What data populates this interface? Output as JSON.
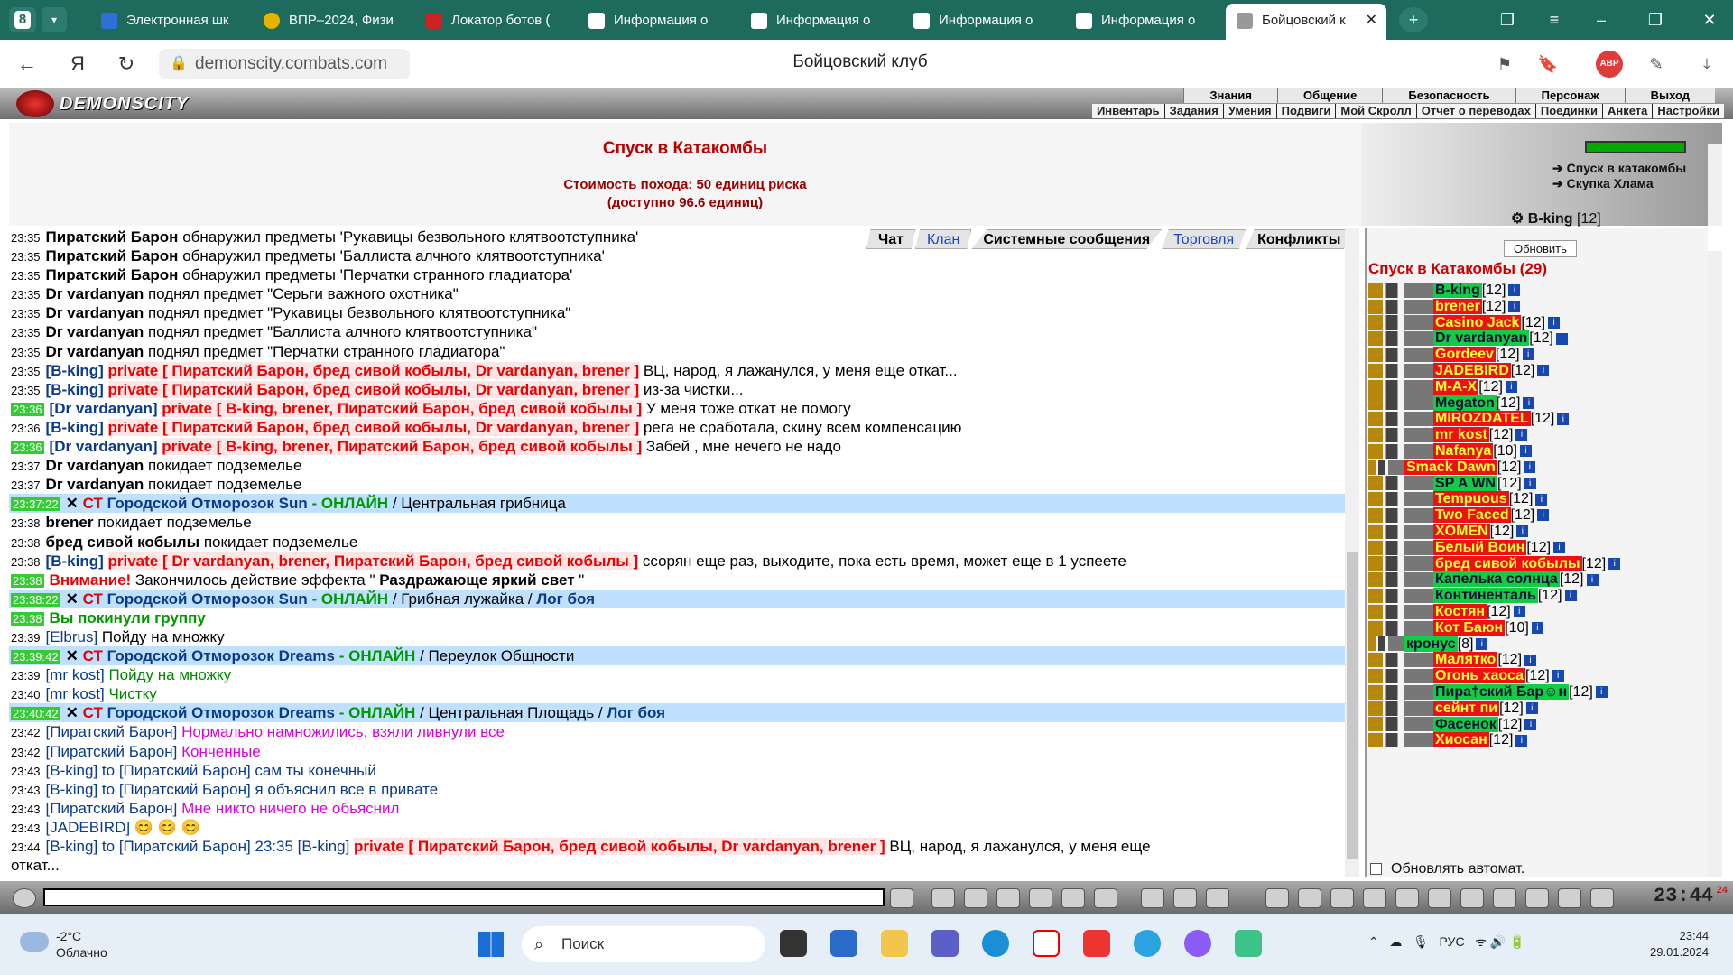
{
  "browser": {
    "tab_count": "8",
    "tabs": [
      {
        "label": "Электронная шк"
      },
      {
        "label": "ВПР–2024, Физи"
      },
      {
        "label": "Локатор ботов ("
      },
      {
        "label": "Информация о"
      },
      {
        "label": "Информация о"
      },
      {
        "label": "Информация о"
      },
      {
        "label": "Информация о"
      },
      {
        "label": "Бойцовский к"
      }
    ],
    "url": "demonscity.combats.com",
    "page_title": "Бойцовский клуб",
    "abp_label": "ABP"
  },
  "game": {
    "logo": "DEMONSCITY",
    "top_menu": [
      "Знания",
      "Общение",
      "Безопасность",
      "Персонаж",
      "Выход"
    ],
    "sub_menu": [
      "Инвентарь",
      "Задания",
      "Умения",
      "Подвиги",
      "Мой Скролл",
      "Отчет о переводах",
      "Поединки",
      "Анкета",
      "Настройки"
    ],
    "info_title": "Спуск в Катакомбы",
    "cost_line1": "Стоимость похода: 50 единиц риска",
    "cost_line2": "(доступно 96.6 единиц)",
    "right_links": [
      "Спуск в катакомбы",
      "Скупка Хлама"
    ],
    "right_user": "B-king",
    "right_user_level": "[12]",
    "chat_tabs": [
      "Чат",
      "Клан",
      "Системные сообщения",
      "Торговля",
      "Конфликты"
    ],
    "clock": "23:44",
    "clock_sec": "24"
  },
  "chat": [
    {
      "time": "23:35",
      "parts": [
        [
          "bold",
          "Пиратский Барон"
        ],
        [
          "",
          "обнаружил предметы 'Рукавицы безвольного клятвоотступника'"
        ]
      ]
    },
    {
      "time": "23:35",
      "parts": [
        [
          "bold",
          "Пиратский Барон"
        ],
        [
          "",
          "обнаружил предметы 'Баллиста алчного клятвоотступника'"
        ]
      ]
    },
    {
      "time": "23:35",
      "parts": [
        [
          "bold",
          "Пиратский Барон"
        ],
        [
          "",
          "обнаружил предметы 'Перчатки странного гладиатора'"
        ]
      ]
    },
    {
      "time": "23:35",
      "parts": [
        [
          "bold",
          "Dr vardanyan"
        ],
        [
          "",
          "поднял предмет \"Серьги важного охотника\""
        ]
      ]
    },
    {
      "time": "23:35",
      "parts": [
        [
          "bold",
          "Dr vardanyan"
        ],
        [
          "",
          "поднял предмет \"Рукавицы безвольного клятвоотступника\""
        ]
      ]
    },
    {
      "time": "23:35",
      "parts": [
        [
          "bold",
          "Dr vardanyan"
        ],
        [
          "",
          "поднял предмет \"Баллиста алчного клятвоотступника\""
        ]
      ]
    },
    {
      "time": "23:35",
      "parts": [
        [
          "bold",
          "Dr vardanyan"
        ],
        [
          "",
          "поднял предмет \"Перчатки странного гладиатора\""
        ]
      ]
    },
    {
      "time": "23:35",
      "parts": [
        [
          "blue",
          "[B-king]"
        ],
        [
          "pv",
          "private [ Пиратский Барон, бред сивой кобылы, Dr vardanyan, brener ]"
        ],
        [
          "",
          "ВЦ, народ, я лажанулся, у меня еще откат..."
        ]
      ]
    },
    {
      "time": "23:35",
      "parts": [
        [
          "blue",
          "[B-king]"
        ],
        [
          "pv",
          "private [ Пиратский Барон, бред сивой кобылы, Dr vardanyan, brener ]"
        ],
        [
          "",
          "из-за чистки..."
        ]
      ]
    },
    {
      "time": "23:36",
      "green": true,
      "parts": [
        [
          "blue",
          "[Dr vardanyan]"
        ],
        [
          "pv",
          "private [ B-king, brener, Пиратский Барон, бред сивой кобылы ]"
        ],
        [
          "",
          "У меня тоже откат не помогу"
        ]
      ]
    },
    {
      "time": "23:36",
      "parts": [
        [
          "blue",
          "[B-king]"
        ],
        [
          "pv",
          "private [ Пиратский Барон, бред сивой кобылы, Dr vardanyan, brener ]"
        ],
        [
          "",
          "рега не сработала, скину всем компенсацию"
        ]
      ]
    },
    {
      "time": "23:36",
      "green": true,
      "parts": [
        [
          "blue",
          "[Dr vardanyan]"
        ],
        [
          "pv",
          "private [ B-king, brener, Пиратский Барон, бред сивой кобылы ]"
        ],
        [
          "",
          "Забей , мне нечего не надо"
        ]
      ]
    },
    {
      "time": "23:37",
      "parts": [
        [
          "bold",
          "Dr vardanyan"
        ],
        [
          "",
          "покидает подземелье"
        ]
      ]
    },
    {
      "time": "23:37",
      "parts": [
        [
          "bold",
          "Dr vardanyan"
        ],
        [
          "",
          "покидает подземелье"
        ]
      ]
    },
    {
      "time": "23:37:22",
      "green": true,
      "sys": true,
      "parts": [
        [
          "bold",
          "✕"
        ],
        [
          "red",
          "СТ"
        ],
        [
          "blue",
          "Городской Отморозок Sun"
        ],
        [
          "",
          ""
        ],
        [
          "grn",
          "- ОНЛАЙН"
        ],
        [
          "",
          "/ Центральная грибница"
        ]
      ]
    },
    {
      "time": "23:38",
      "parts": [
        [
          "bold",
          "brener"
        ],
        [
          "",
          "покидает подземелье"
        ]
      ]
    },
    {
      "time": "23:38",
      "parts": [
        [
          "bold",
          "бред сивой кобылы"
        ],
        [
          "",
          "покидает подземелье"
        ]
      ]
    },
    {
      "time": "23:38",
      "parts": [
        [
          "blue",
          "[B-king]"
        ],
        [
          "pv",
          "private [ Dr vardanyan, brener, Пиратский Барон, бред сивой кобылы ]"
        ],
        [
          "",
          "ссорян еще раз, выходите, пока есть время, может еще в 1 успеете"
        ]
      ]
    },
    {
      "time": "23:38",
      "green": true,
      "parts": [
        [
          "red",
          "Внимание!"
        ],
        [
          "",
          "Закончилось действие эффекта \""
        ],
        [
          "bold",
          "Раздражающе яркий свет"
        ],
        [
          "",
          "\""
        ]
      ]
    },
    {
      "time": "23:38:22",
      "green": true,
      "sys": true,
      "parts": [
        [
          "bold",
          "✕"
        ],
        [
          "red",
          "СТ"
        ],
        [
          "blue",
          "Городской Отморозок Sun"
        ],
        [
          "grn",
          "- ОНЛАЙН"
        ],
        [
          "",
          "/ Грибная лужайка /"
        ],
        [
          "blue",
          "Лог боя"
        ]
      ]
    },
    {
      "time": "23:38",
      "green": true,
      "parts": [
        [
          "grn",
          "Вы покинули группу"
        ]
      ]
    },
    {
      "time": "23:39",
      "parts": [
        [
          "br",
          "[Elbrus]"
        ],
        [
          "",
          "Пойду на множку"
        ]
      ]
    },
    {
      "time": "23:39:42",
      "green": true,
      "sys": true,
      "parts": [
        [
          "bold",
          "✕"
        ],
        [
          "red",
          "СТ"
        ],
        [
          "blue",
          "Городской Отморозок Dreams"
        ],
        [
          "grn",
          "- ОНЛАЙН"
        ],
        [
          "",
          "/ Переулок Общности"
        ]
      ]
    },
    {
      "time": "23:39",
      "parts": [
        [
          "br",
          "[mr kost]"
        ],
        [
          "dgrn",
          "Пойду на множку"
        ]
      ]
    },
    {
      "time": "23:40",
      "parts": [
        [
          "br",
          "[mr kost]"
        ],
        [
          "dgrn",
          "Чистку"
        ]
      ]
    },
    {
      "time": "23:40:42",
      "green": true,
      "sys": true,
      "parts": [
        [
          "bold",
          "✕"
        ],
        [
          "red",
          "СТ"
        ],
        [
          "blue",
          "Городской Отморозок Dreams"
        ],
        [
          "grn",
          "- ОНЛАЙН"
        ],
        [
          "",
          "/ Центральная Площадь /"
        ],
        [
          "blue",
          "Лог боя"
        ]
      ]
    },
    {
      "time": "23:42",
      "parts": [
        [
          "br",
          "[Пиратский Барон]"
        ],
        [
          "pink",
          "Нормально намножились, взяли ливнули все"
        ]
      ]
    },
    {
      "time": "23:42",
      "parts": [
        [
          "br",
          "[Пиратский Барон]"
        ],
        [
          "pink",
          "Конченные"
        ]
      ]
    },
    {
      "time": "23:43",
      "parts": [
        [
          "br",
          "[B-king]"
        ],
        [
          "br",
          "to [Пиратский Барон] сам ты конечный"
        ]
      ]
    },
    {
      "time": "23:43",
      "parts": [
        [
          "br",
          "[B-king]"
        ],
        [
          "br",
          "to [Пиратский Барон] я объяснил все в привате"
        ]
      ]
    },
    {
      "time": "23:43",
      "parts": [
        [
          "br",
          "[Пиратский Барон]"
        ],
        [
          "pink",
          "Мне никто ничего не обьяснил"
        ]
      ]
    },
    {
      "time": "23:43",
      "parts": [
        [
          "br",
          "[JADEBIRD]"
        ],
        [
          "",
          "😊 😊 😊"
        ]
      ]
    },
    {
      "time": "23:44",
      "parts": [
        [
          "br",
          "[B-king]"
        ],
        [
          "br",
          "to [Пиратский Барон] 23:35 [B-king]"
        ],
        [
          "pv",
          "private [ Пиратский Барон, бред сивой кобылы, Dr vardanyan, brener ]"
        ],
        [
          "",
          "ВЦ, народ, я лажанулся, у меня еще"
        ]
      ]
    },
    {
      "time": "",
      "parts": [
        [
          "",
          "откат..."
        ]
      ]
    }
  ],
  "userlist": {
    "refresh_label": "Обновить",
    "title": "Спуск в Катакомбы (29)",
    "auto_refresh_label": "Обновлять автомат.",
    "users": [
      {
        "name": "B-king",
        "level": "[12]",
        "style": "gr"
      },
      {
        "name": "brener",
        "level": "[12]",
        "style": "r"
      },
      {
        "name": "Casino Jack",
        "level": "[12]",
        "style": "r"
      },
      {
        "name": "Dr vardanyan",
        "level": "[12]",
        "style": "gr"
      },
      {
        "name": "Gordeev",
        "level": "[12]",
        "style": "r"
      },
      {
        "name": "JADEBIRD",
        "level": "[12]",
        "style": "r"
      },
      {
        "name": "M-A-X",
        "level": "[12]",
        "style": "r"
      },
      {
        "name": "Megaton",
        "level": "[12]",
        "style": "gr"
      },
      {
        "name": "MIROZDATEL",
        "level": "[12]",
        "style": "r"
      },
      {
        "name": "mr kost",
        "level": "[12]",
        "style": "r"
      },
      {
        "name": "Nafanya",
        "level": "[10]",
        "style": "r"
      },
      {
        "name": "Smack Dawn",
        "level": "[12]",
        "style": "r",
        "short": true
      },
      {
        "name": "SP A WN",
        "level": "[12]",
        "style": "gr"
      },
      {
        "name": "Tempuous",
        "level": "[12]",
        "style": "r"
      },
      {
        "name": "Two Faced",
        "level": "[12]",
        "style": "r"
      },
      {
        "name": "XOMEN",
        "level": "[12]",
        "style": "r"
      },
      {
        "name": "Белый Воин",
        "level": "[12]",
        "style": "r"
      },
      {
        "name": "бред сивой кобылы",
        "level": "[12]",
        "style": "r"
      },
      {
        "name": "Капелька солнца",
        "level": "[12]",
        "style": "gr"
      },
      {
        "name": "Континенталь",
        "level": "[12]",
        "style": "gr"
      },
      {
        "name": "Костян",
        "level": "[12]",
        "style": "r"
      },
      {
        "name": "Кот Баюн",
        "level": "[10]",
        "style": "r"
      },
      {
        "name": "кронус",
        "level": "[8]",
        "style": "gr",
        "short": true
      },
      {
        "name": "Малятко",
        "level": "[12]",
        "style": "r"
      },
      {
        "name": "Огонь хаоса",
        "level": "[12]",
        "style": "r"
      },
      {
        "name": "Пира†ский Бар☺н",
        "level": "[12]",
        "style": "gr"
      },
      {
        "name": "сейнт пи",
        "level": "[12]",
        "style": "r"
      },
      {
        "name": "Фасенок",
        "level": "[12]",
        "style": "gr"
      },
      {
        "name": "Хиосан",
        "level": "[12]",
        "style": "r"
      }
    ]
  },
  "taskbar": {
    "weather_temp": "-2°C",
    "weather_desc": "Облачно",
    "search_label": "Поиск",
    "lang": "РУС",
    "time": "23:44",
    "date": "29.01.2024"
  },
  "colors": {
    "accent": "#1e6b5e",
    "alert": "#e00000",
    "online": "#009900"
  }
}
